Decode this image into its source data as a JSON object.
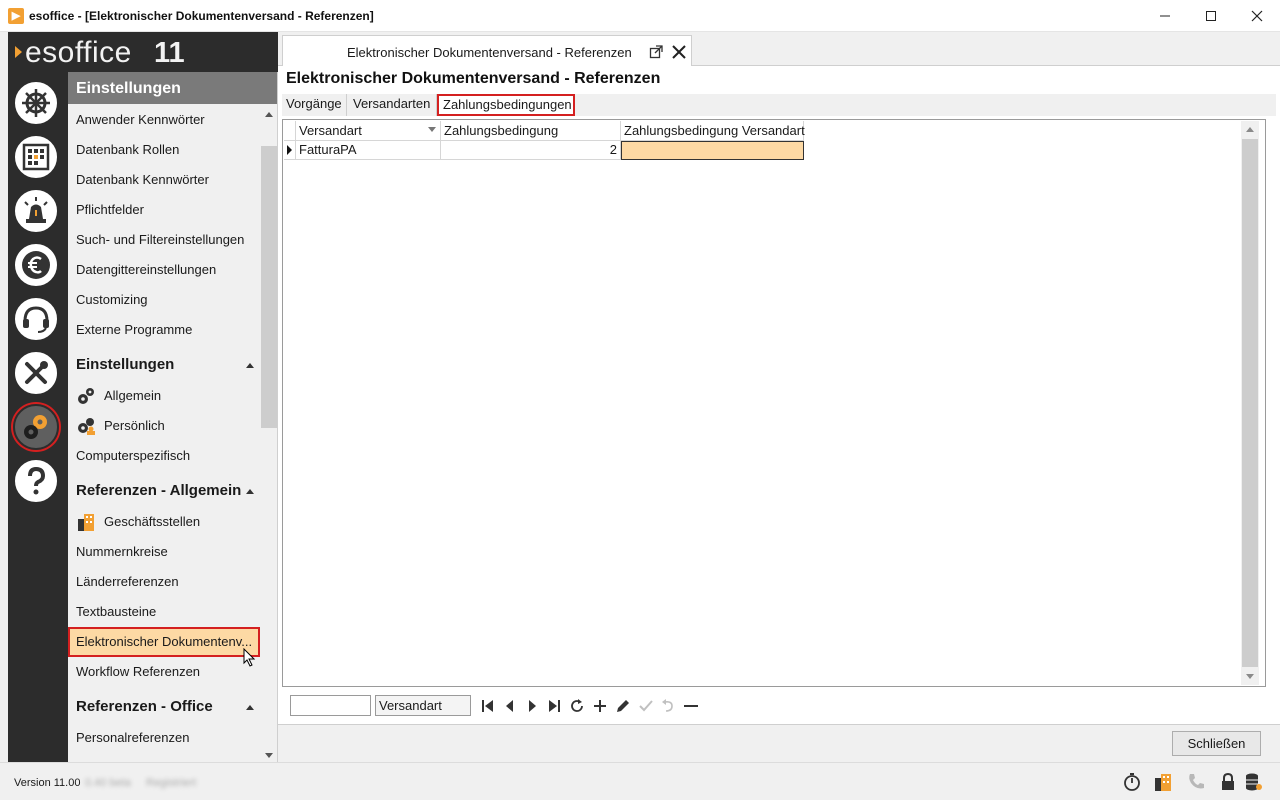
{
  "window": {
    "title": "esoffice - [Elektronischer Dokumentenversand - Referenzen]",
    "app_icon": "esoffice-logo-icon",
    "minimize_icon": "minimize-icon",
    "maximize_icon": "maximize-icon",
    "close_icon": "close-icon"
  },
  "brand": {
    "name": "esoffice",
    "version_num": "11",
    "accent_color": "#f2a033"
  },
  "rail": {
    "buttons": [
      {
        "name": "ship-wheel-icon"
      },
      {
        "name": "calendar-grid-icon"
      },
      {
        "name": "alarm-light-icon"
      },
      {
        "name": "euro-icon"
      },
      {
        "name": "headset-icon"
      },
      {
        "name": "tools-icon"
      },
      {
        "name": "gears-icon",
        "active": true
      },
      {
        "name": "help-icon"
      }
    ]
  },
  "nav": {
    "header": "Einstellungen",
    "items_top": [
      "Anwender Kennwörter",
      "Datenbank Rollen",
      "Datenbank Kennwörter",
      "Pflichtfelder",
      "Such- und Filtereinstellungen",
      "Datengittereinstellungen",
      "Customizing",
      "Externe Programme"
    ],
    "section_einstellungen": "Einstellungen",
    "allgemein": "Allgemein",
    "persoenlich": "Persönlich",
    "computerspezifisch": "Computerspezifisch",
    "section_ref_allgemein": "Referenzen - Allgemein",
    "geschaeftsstellen": "Geschäftsstellen",
    "nummernkreise": "Nummernkreise",
    "laenderreferenzen": "Länderreferenzen",
    "textbausteine": "Textbausteine",
    "elektronischer": "Elektronischer Dokumentenv...",
    "workflow": "Workflow Referenzen",
    "section_ref_office": "Referenzen - Office",
    "personalreferenzen": "Personalreferenzen"
  },
  "tab": {
    "label": "Elektronischer Dokumentenversand - Referenzen"
  },
  "page": {
    "title": "Elektronischer Dokumentenversand - Referenzen",
    "subtabs": [
      "Vorgänge",
      "Versandarten",
      "Zahlungsbedingungen"
    ],
    "active_subtab": "Zahlungsbedingungen"
  },
  "grid": {
    "columns": [
      "Versandart",
      "Zahlungsbedingung",
      "Zahlungsbedingung Versandart"
    ],
    "rows": [
      {
        "versandart": "FatturaPA",
        "zahlungsbedingung": "2",
        "zahlungsbedingung_versandart": ""
      }
    ],
    "highlight_color": "#fdd9a4"
  },
  "navigator": {
    "search_value": "",
    "field_label": "Versandart"
  },
  "footer": {
    "close_label": "Schließen"
  },
  "status": {
    "version": "Version 11.00",
    "blur_a": "0.40 beta",
    "blur_b": "Registriert"
  },
  "colors": {
    "selection_border": "#d42020",
    "rail_bg": "#2c2c2c",
    "nav_header_bg": "#7a7a7a"
  }
}
